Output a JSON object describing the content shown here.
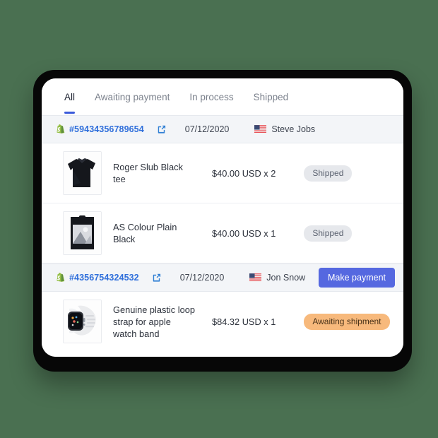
{
  "tabs": [
    {
      "label": "All",
      "active": true
    },
    {
      "label": "Awaiting payment",
      "active": false
    },
    {
      "label": "In process",
      "active": false
    },
    {
      "label": "Shipped",
      "active": false
    }
  ],
  "orders": [
    {
      "shop_icon": "shopify-icon",
      "order_id": "#59434356789654",
      "external_link_icon": "external-link-icon",
      "date": "07/12/2020",
      "flag_icon": "us-flag-icon",
      "customer": "Steve Jobs",
      "action_button": null,
      "items": [
        {
          "thumbnail": "black-tee-thumbnail",
          "name": "Roger Slub Black tee",
          "price": "$40.00 USD x 2",
          "status": "Shipped",
          "status_kind": "shipped"
        },
        {
          "thumbnail": "packaged-black-shirt-thumbnail",
          "name": "AS Colour Plain Black",
          "price": "$40.00 USD x 1",
          "status": "Shipped",
          "status_kind": "shipped"
        }
      ]
    },
    {
      "shop_icon": "shopify-icon",
      "order_id": "#4356754324532",
      "external_link_icon": "external-link-icon",
      "date": "07/12/2020",
      "flag_icon": "us-flag-icon",
      "customer": "Jon Snow",
      "action_button": "Make payment",
      "items": [
        {
          "thumbnail": "apple-watch-band-thumbnail",
          "name": "Genuine plastic loop strap for apple watch band",
          "price": "$84.32 USD x 1",
          "status": "Awaiting shipment",
          "status_kind": "awaiting"
        }
      ]
    }
  ],
  "colors": {
    "background": "#4a7051",
    "accent_blue": "#3b5bdb",
    "link_blue": "#2f6fdb",
    "button_purple": "#5568e0",
    "badge_shipped_bg": "#e6e8ec",
    "badge_awaiting_bg": "#f7b97c",
    "row_header_bg": "#f3f5f8"
  }
}
